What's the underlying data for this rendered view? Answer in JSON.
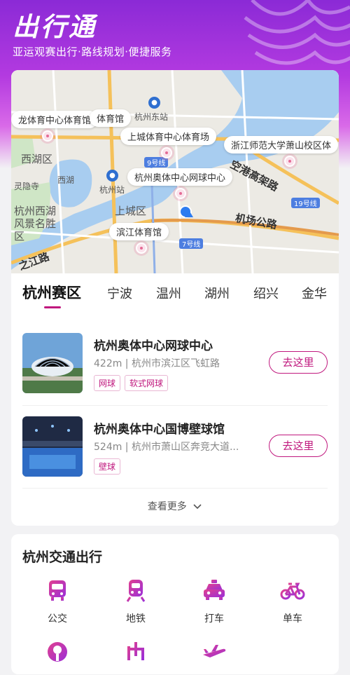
{
  "header": {
    "title": "出行通",
    "subtitle": "亚运观赛出行·路线规划·便捷服务"
  },
  "map": {
    "area_labels": [
      "西湖区",
      "西湖",
      "上城区",
      "杭州西湖风景名胜区",
      "灵隐寺",
      "杭州站",
      "杭州东站"
    ],
    "road_labels": [
      "空港高架路",
      "机场公路",
      "之江路"
    ],
    "line_badges": [
      "9号线",
      "19号线",
      "7号线"
    ],
    "poi_labels": [
      "龙体育中心体育馆",
      "体育馆",
      "上城体育中心体育场",
      "浙江师范大学萧山校区体",
      "杭州奥体中心网球中心",
      "滨江体育馆"
    ]
  },
  "tabs": {
    "items": [
      "杭州赛区",
      "宁波",
      "温州",
      "湖州",
      "绍兴",
      "金华"
    ],
    "active": "杭州赛区"
  },
  "venues": [
    {
      "name": "杭州奥体中心网球中心",
      "distance": "422m",
      "address": "杭州市滨江区飞虹路",
      "tags": [
        "网球",
        "软式网球"
      ],
      "action": "去这里"
    },
    {
      "name": "杭州奥体中心国博壁球馆",
      "distance": "524m",
      "address": "杭州市萧山区奔竞大道...",
      "tags": [
        "壁球"
      ],
      "action": "去这里"
    }
  ],
  "more_label": "查看更多",
  "traffic": {
    "title": "杭州交通出行",
    "items": [
      {
        "label": "公交",
        "icon": "bus-icon"
      },
      {
        "label": "地铁",
        "icon": "subway-icon"
      },
      {
        "label": "打车",
        "icon": "taxi-icon"
      },
      {
        "label": "单车",
        "icon": "bicycle-icon"
      },
      {
        "label": "",
        "icon": "train-icon"
      },
      {
        "label": "",
        "icon": "route-icon"
      },
      {
        "label": "",
        "icon": "plane-icon"
      }
    ]
  },
  "colors": {
    "brand": "#c0187e",
    "header_gradient_start": "#8b2ad6",
    "location_blue": "#2d7cf0"
  }
}
